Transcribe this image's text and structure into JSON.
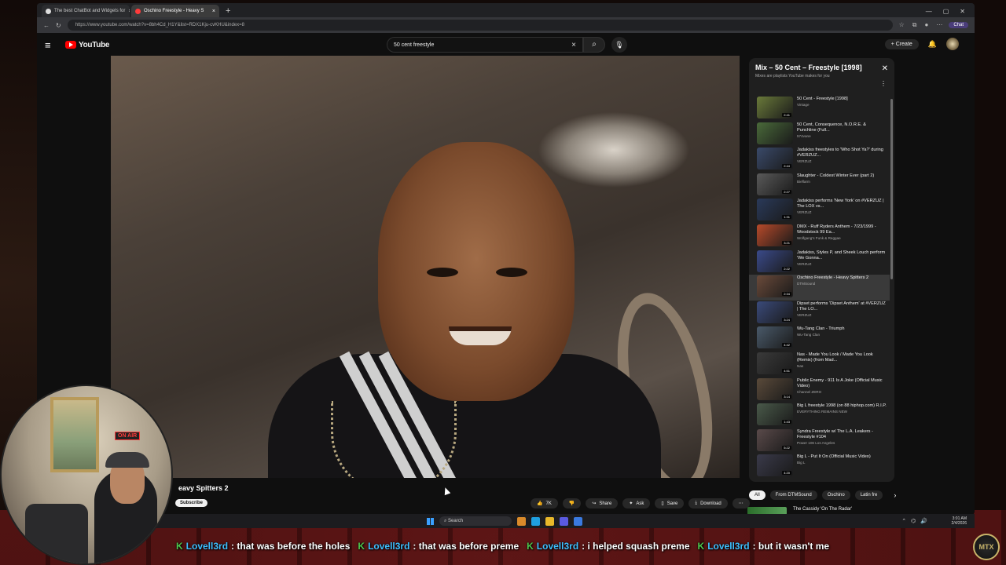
{
  "browser": {
    "tabs": [
      {
        "title": "The best ChatBot and Widgets for",
        "color": "#ffffff",
        "active": false
      },
      {
        "title": "Oschino Freestyle - Heavy S",
        "color": "#ff3b3b",
        "active": true
      }
    ],
    "url": "https://www.youtube.com/watch?v=8bh4Cd_H1Y&list=RDX1Kju-cvKHU&index=8",
    "chat_button": "Chat"
  },
  "youtube": {
    "logo": "YouTube",
    "search_value": "50 cent freestyle",
    "create_label": "Create"
  },
  "video": {
    "title_visible": "eavy Spitters 2",
    "subscribe_label": "Subscribe",
    "actions": [
      {
        "icon": "thumbs-up-icon",
        "label": "7K"
      },
      {
        "icon": "thumbs-down-icon",
        "label": ""
      },
      {
        "icon": "share-icon",
        "label": "Share"
      },
      {
        "icon": "sparkle-icon",
        "label": "Ask"
      },
      {
        "icon": "save-icon",
        "label": "Save"
      },
      {
        "icon": "download-icon",
        "label": "Download"
      },
      {
        "icon": "more-icon",
        "label": "⋯"
      }
    ]
  },
  "playlist": {
    "title": "Mix – 50 Cent – Freestyle [1998]",
    "subtitle": "Mixes are playlists YouTube makes for you",
    "items": [
      {
        "title": "50 Cent - Freestyle [1998]",
        "channel": "Vintage",
        "duration": "2:41",
        "color": "#6a7a3a"
      },
      {
        "title": "50 Cent, Consequence, N.O.R.E. & Punchline (Full...",
        "channel": "574vane",
        "duration": "",
        "color": "#4a6a3a"
      },
      {
        "title": "Jadakiss freestyles to 'Who Shot Ya?' during #VERZUZ...",
        "channel": "VERZUZ",
        "duration": "2:44",
        "color": "#3a4a6a"
      },
      {
        "title": "Slaughter - Coldest Winter Ever (part 2)",
        "channel": "Bieflarm",
        "duration": "2:27",
        "color": "#5a5a5a"
      },
      {
        "title": "Jadakiss performs 'New York' on #VERZUZ | The LOX vs...",
        "channel": "VERZUZ",
        "duration": "1:31",
        "color": "#2a3a5a"
      },
      {
        "title": "DMX - Ruff Ryders Anthem - 7/23/1999 - Woodstock 99 Ea...",
        "channel": "Wolfgang's Funk & Reggae",
        "duration": "3:21",
        "color": "#b84a2a"
      },
      {
        "title": "Jadakiss, Styles P, and Sheek Louch perform 'We Gonna...",
        "channel": "VERZUZ",
        "duration": "2:22",
        "color": "#3a4a8a"
      },
      {
        "title": "Oschino Freestyle - Heavy Spitters 2",
        "channel": "DTMSound",
        "duration": "2:34",
        "color": "#6a4a3a",
        "active": true
      },
      {
        "title": "Dipset performs 'Dipset Anthem' at #VERZUZ | The LO...",
        "channel": "VERZUZ",
        "duration": "3:24",
        "color": "#3a4a7a"
      },
      {
        "title": "Wu-Tang Clan - Triumph",
        "channel": "Wu-Tang Clan",
        "duration": "4:42",
        "color": "#4a5a6a"
      },
      {
        "title": "Nas - Made You Look / Made You Look (Remix) (from Mad...",
        "channel": "Nas",
        "duration": "4:51",
        "color": "#3a3a3a"
      },
      {
        "title": "Public Enemy - 911 Is A Joke (Official Music Video)",
        "channel": "Channel ZERO",
        "duration": "3:14",
        "color": "#5a4a3a"
      },
      {
        "title": "Big L freestyle 1998 (on 88 hiphop.com) R.I.P.",
        "channel": "EVERYTHING REMAINS NEW",
        "duration": "1:43",
        "color": "#4a5a4a"
      },
      {
        "title": "Syndra Freestyle w/ The L.A. Leakers - Freestyle #104",
        "channel": "Power 106 Los Angeles",
        "duration": "5:22",
        "color": "#5a4a4a"
      },
      {
        "title": "Big L - Put It On (Official Music Video)",
        "channel": "Big L",
        "duration": "4:20",
        "color": "#3a3a4a"
      }
    ],
    "chips": [
      {
        "label": "All",
        "selected": true
      },
      {
        "label": "From DTMSound",
        "selected": false
      },
      {
        "label": "Oschino",
        "selected": false
      },
      {
        "label": "Latin fre",
        "selected": false
      }
    ],
    "next_title": "The Cassidy 'On The Radar'"
  },
  "taskbar": {
    "search_label": "Search",
    "time": "3:01 AM",
    "date": "2/4/2026"
  },
  "webcam": {
    "sign": "ON AIR"
  },
  "chat": [
    {
      "user": "Lovell3rd",
      "text": ": that was before the holes"
    },
    {
      "user": "Lovell3rd",
      "text": ": that was before preme"
    },
    {
      "user": "Lovell3rd",
      "text": ": i helped squash preme"
    },
    {
      "user": "Lovell3rd",
      "text": ": but it wasn't me"
    }
  ],
  "badge": "MTX"
}
